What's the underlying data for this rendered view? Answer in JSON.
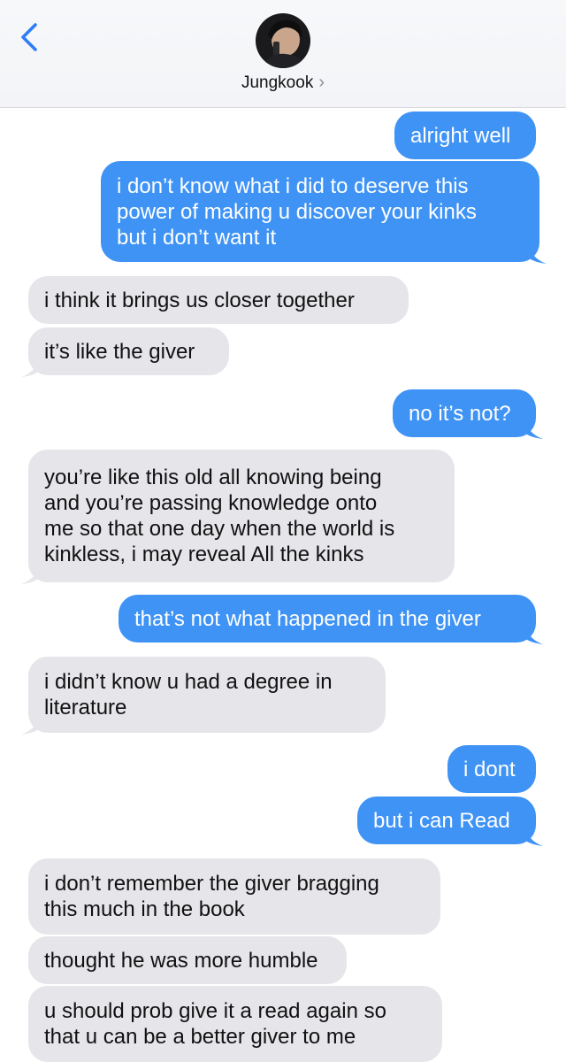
{
  "header": {
    "contact_name": "Jungkook",
    "chevron": "›",
    "back_icon": "chevron-left-icon",
    "accent_color": "#2f7cf6"
  },
  "colors": {
    "sent_bubble": "#3f93f5",
    "received_bubble": "#e5e5ea"
  },
  "messages": [
    {
      "from": "me",
      "text": "alright well"
    },
    {
      "from": "me",
      "text": "i don’t know what i did to deserve this\npower of making u discover your kinks\nbut i don’t want it"
    },
    {
      "from": "them",
      "text": "i think it brings us closer together"
    },
    {
      "from": "them",
      "text": "it’s like the giver"
    },
    {
      "from": "me",
      "text": "no it’s not?"
    },
    {
      "from": "them",
      "text": "you’re like this old all knowing being\nand you’re passing knowledge onto\nme so that one day when the world is\nkinkless, i may reveal All the kinks"
    },
    {
      "from": "me",
      "text": "that’s not what happened in the giver"
    },
    {
      "from": "them",
      "text": "i didn’t know u had a degree in\nliterature"
    },
    {
      "from": "me",
      "text": "i dont"
    },
    {
      "from": "me",
      "text": "but i can Read"
    },
    {
      "from": "them",
      "text": "i don’t remember the giver bragging\nthis much in the book"
    },
    {
      "from": "them",
      "text": "thought he was more humble"
    },
    {
      "from": "them",
      "text": "u should prob give it a read again so\nthat u can be a better giver to me"
    }
  ]
}
